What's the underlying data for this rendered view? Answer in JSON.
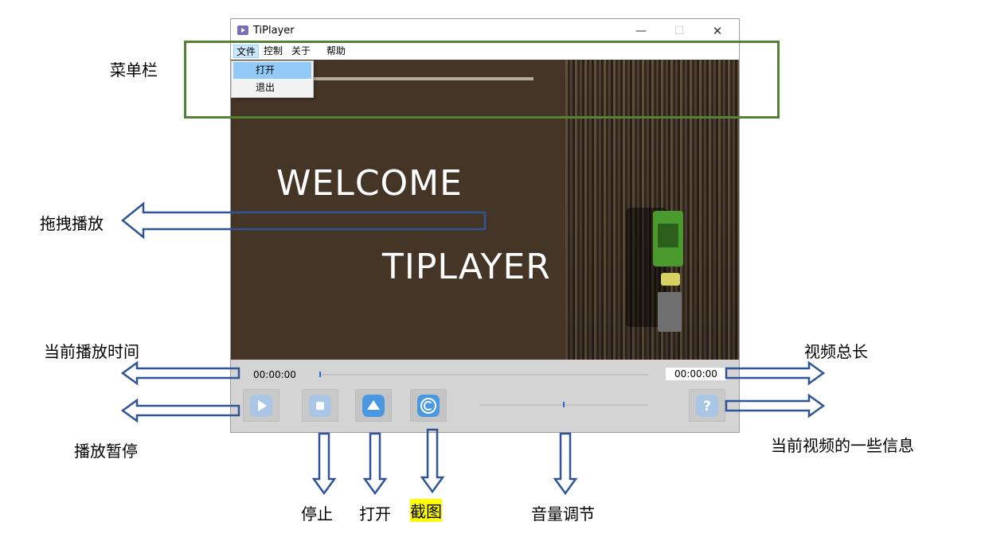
{
  "window": {
    "title": "TiPlayer",
    "controls": {
      "minimize": "—",
      "maximize": "☐",
      "close": "✕"
    }
  },
  "menubar": {
    "items": [
      "文件",
      "控制",
      "关于",
      "帮助"
    ],
    "active_index": 0
  },
  "file_menu": {
    "items": [
      "打开",
      "退出"
    ],
    "highlighted_index": 0
  },
  "video": {
    "line1": "WELCOME",
    "line2": "TIPLAYER"
  },
  "controls": {
    "current_time": "00:00:00",
    "total_time": "00:00:00",
    "progress": 0.0,
    "volume": 0.5,
    "buttons": [
      {
        "name": "play-pause",
        "icon": "play-icon",
        "enabled": false
      },
      {
        "name": "stop",
        "icon": "stop-icon",
        "enabled": false
      },
      {
        "name": "open",
        "icon": "eject-icon",
        "enabled": true
      },
      {
        "name": "screenshot",
        "icon": "copyright-icon",
        "enabled": true
      },
      {
        "name": "info",
        "icon": "question-icon",
        "enabled": false
      }
    ]
  },
  "annotations": {
    "menubar": "菜单栏",
    "drag_play": "拖拽播放",
    "current_time": "当前播放时间",
    "total_length": "视频总长",
    "play_pause": "播放暂停",
    "video_info": "当前视频的一些信息",
    "stop": "停止",
    "open": "打开",
    "screenshot": "截图",
    "volume": "音量调节"
  },
  "colors": {
    "annotation_box": "#548235",
    "arrow": "#2f5597",
    "accent_button": "#4a98e0",
    "screenshot_highlight": "#ffff00"
  }
}
